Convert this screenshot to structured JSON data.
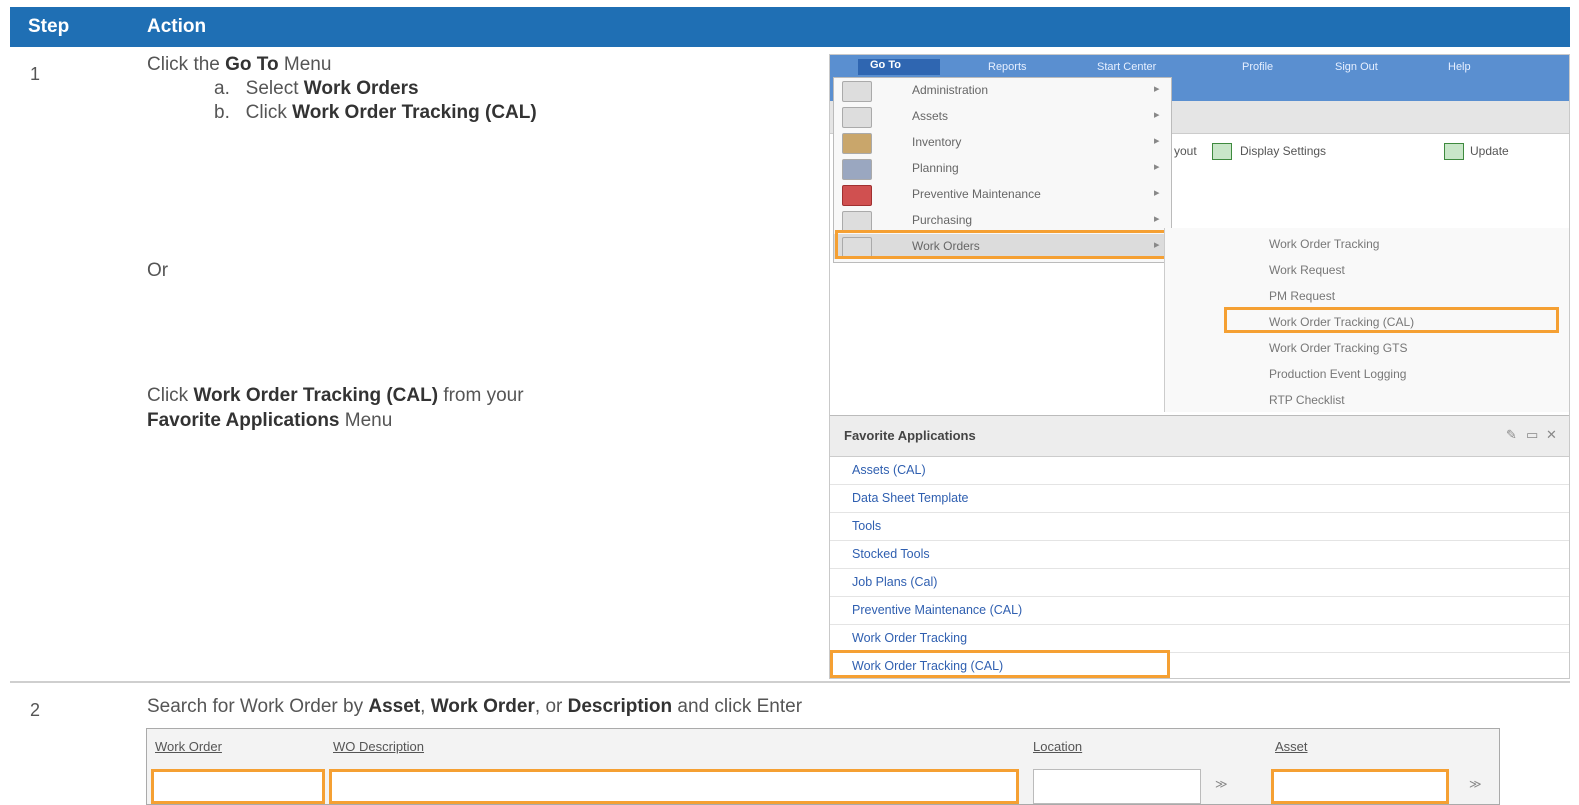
{
  "header": {
    "col1": "Step",
    "col2": "Action"
  },
  "step1": {
    "number": "1",
    "line1_pre": "Click the ",
    "line1_b": "Go To",
    "line1_post": " Menu",
    "line2_pre": "a.   Select ",
    "line2_b": "Work Orders",
    "line3_pre": "b.   Click ",
    "line3_b": "Work Order Tracking (CAL)",
    "or": "Or",
    "fav_pre": "Click ",
    "fav_b1": "Work Order Tracking (CAL)",
    "fav_mid": " from your",
    "fav_b2": "Favorite Applications",
    "fav_post": " Menu"
  },
  "screenshot": {
    "goto": "Go To",
    "topnav": [
      "Reports",
      "Start Center",
      "Profile",
      "Sign Out",
      "Help"
    ],
    "toolbar": {
      "layout": "yout",
      "display_settings": "Display Settings",
      "update": "Update"
    },
    "goto_menu": [
      "Administration",
      "Assets",
      "Inventory",
      "Planning",
      "Preventive Maintenance",
      "Purchasing",
      "Work Orders"
    ],
    "submenu": [
      "Work Order Tracking",
      "Work Request",
      "PM Request",
      "Work Order Tracking (CAL)",
      "Work Order Tracking GTS",
      "Production Event Logging",
      "RTP Checklist"
    ],
    "favorites": {
      "title": "Favorite Applications",
      "items": [
        "Assets (CAL)",
        "Data Sheet Template",
        "Tools",
        "Stocked Tools",
        "Job Plans (Cal)",
        "Preventive Maintenance (CAL)",
        "Work Order Tracking",
        "Work Order Tracking (CAL)"
      ]
    }
  },
  "step2": {
    "number": "2",
    "pre": "Search for Work Order by ",
    "b1": "Asset",
    "sep1": ", ",
    "b2": "Work Order",
    "sep2": ", or ",
    "b3": "Description",
    "post": " and click Enter",
    "columns": [
      "Work Order",
      "WO Description",
      "Location",
      "Asset"
    ]
  },
  "colors": {
    "header": "#1f6fb4",
    "highlight": "#f5a033",
    "link": "#2f5fb0"
  }
}
